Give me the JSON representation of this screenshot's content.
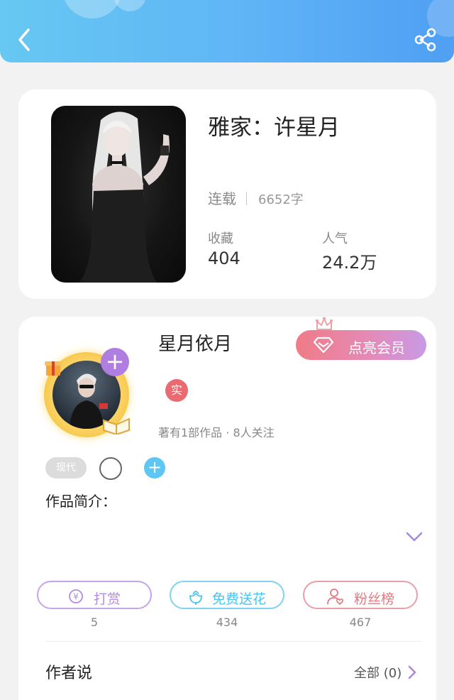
{
  "book": {
    "title": "雅家：许星月",
    "status": "连载",
    "word_count": "6652字",
    "stats": [
      {
        "label": "收藏",
        "value": "404"
      },
      {
        "label": "人气",
        "value": "24.2万"
      }
    ]
  },
  "author": {
    "name": "星月依月",
    "vip_button": "点亮会员",
    "real_badge": "实",
    "meta": "著有1部作品 · 8人关注",
    "tag": "现代",
    "intro_label": "作品简介："
  },
  "actions": [
    {
      "label": "打赏",
      "count": "5",
      "color": "#b58be0"
    },
    {
      "label": "免费送花",
      "count": "434",
      "color": "#4cc3ec"
    },
    {
      "label": "粉丝榜",
      "count": "467",
      "color": "#e07a80"
    }
  ],
  "author_says": {
    "title": "作者说",
    "all_label": "全部 (0)"
  },
  "icons": {
    "back": "chevron-left-icon",
    "share": "share-icon",
    "crown": "crown-icon",
    "diamond": "diamond-icon",
    "reward": "yen-coin-icon",
    "flower": "flower-icon",
    "fans": "user-heart-icon",
    "expand": "chevron-down-icon",
    "all": "chevron-right-icon"
  },
  "colors": {
    "header_start": "#67c8f2",
    "header_end": "#4f9ff3",
    "vip_gradient_start": "#f07b87",
    "vip_gradient_end": "#c89ae6",
    "purple_accent": "#b07ee0",
    "blue_accent": "#5ec6f2",
    "real_badge": "#ea6a72"
  }
}
